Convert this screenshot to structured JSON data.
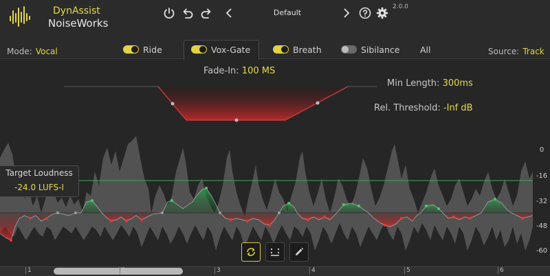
{
  "app": {
    "name_line1": "DynAssist",
    "name_line2": "NoiseWorks",
    "version": "2.0.0"
  },
  "toolbar": {
    "preset": "Default",
    "power_icon": "power-icon",
    "undo_icon": "undo-icon",
    "redo_icon": "redo-icon",
    "prev_icon": "chevron-left-icon",
    "next_icon": "chevron-right-icon",
    "help_icon": "help-icon",
    "settings_icon": "gear-icon"
  },
  "mode": {
    "label": "Mode:",
    "value": "Vocal"
  },
  "source": {
    "label": "Source:",
    "value": "Track"
  },
  "tabs": [
    {
      "label": "Ride",
      "enabled": true,
      "active": false
    },
    {
      "label": "Vox-Gate",
      "enabled": true,
      "active": true
    },
    {
      "label": "Breath",
      "enabled": true,
      "active": false
    },
    {
      "label": "Sibilance",
      "enabled": false,
      "active": false
    },
    {
      "label": "All",
      "enabled": null,
      "active": false
    }
  ],
  "gate": {
    "fade_in_label": "Fade-In:",
    "fade_in_value": "100 MS",
    "min_length_label": "Min Length:",
    "min_length_value": "300ms",
    "rel_threshold_label": "Rel. Threshold:",
    "rel_threshold_value": "-Inf dB"
  },
  "loudness": {
    "label": "Target Loudness",
    "value": "-24.0 LUFS-I"
  },
  "db_scale": [
    "0",
    "-16",
    "-32",
    "-48",
    "-60"
  ],
  "timeline": {
    "markers": [
      "1",
      "2",
      "3",
      "4",
      "5",
      "6"
    ]
  },
  "tools": [
    {
      "name": "loop-icon",
      "active": true
    },
    {
      "name": "range-icon",
      "active": false
    },
    {
      "name": "pencil-icon",
      "active": false
    }
  ],
  "colors": {
    "accent": "#e3d64d",
    "gain_up": "#2f9a4a",
    "gain_down": "#c83030",
    "target_line": "#3ea85a",
    "waveform": "#5b5b5b"
  }
}
